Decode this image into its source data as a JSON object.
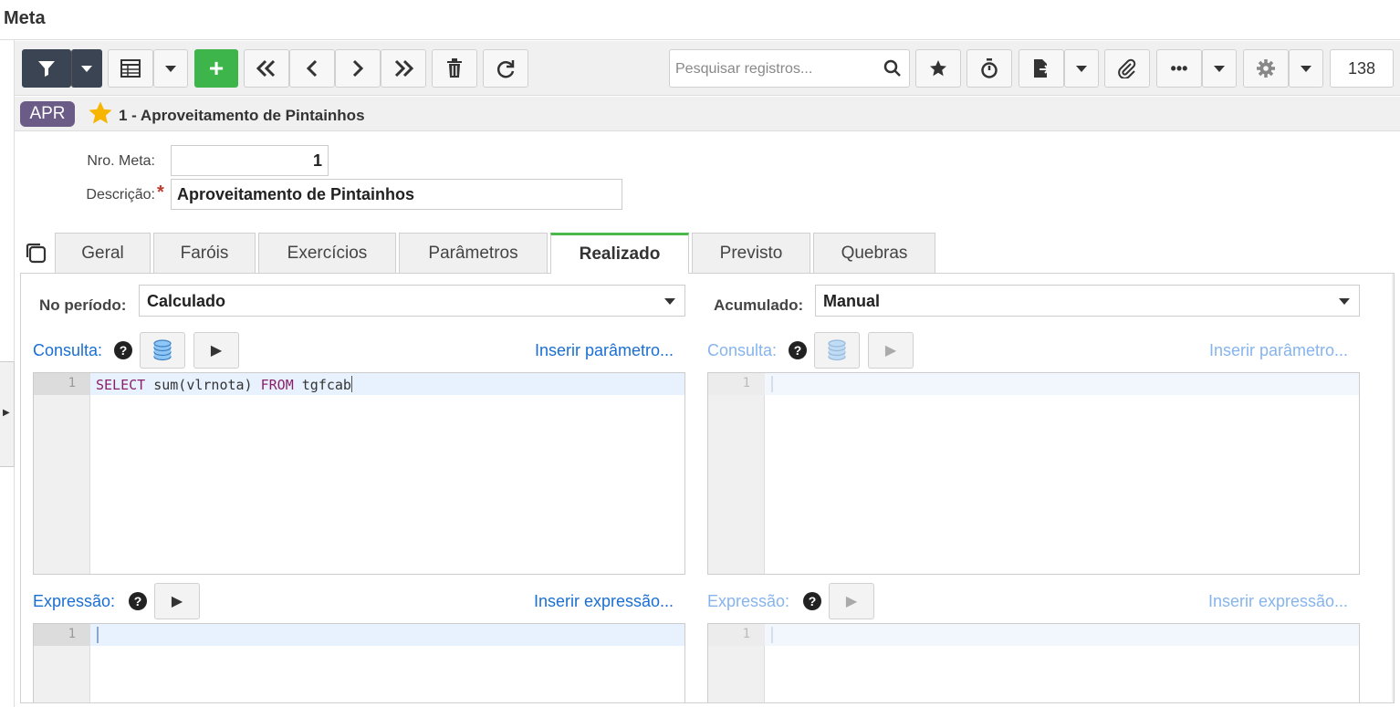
{
  "window": {
    "title": "Meta"
  },
  "toolbar": {
    "search_placeholder": "Pesquisar registros...",
    "record_count": "138",
    "icons": [
      "filter-icon",
      "grid-icon",
      "add-icon",
      "first-icon",
      "prev-icon",
      "next-icon",
      "last-icon",
      "trash-icon",
      "refresh-icon",
      "search-icon",
      "star-icon",
      "stopwatch-icon",
      "export-icon",
      "paperclip-icon",
      "more-icon",
      "gear-icon"
    ],
    "colors": {
      "add": "#3db54a",
      "filter": "#3a4452"
    }
  },
  "record": {
    "badge": "APR",
    "badge_color": "#6b5b87",
    "title": "1 - Aproveitamento de Pintainhos"
  },
  "form": {
    "nro_label": "Nro. Meta:",
    "nro_value": "1",
    "desc_label": "Descrição:",
    "desc_required": "*",
    "desc_value": "Aproveitamento de Pintainhos"
  },
  "tabs": [
    {
      "label": "Geral"
    },
    {
      "label": "Faróis"
    },
    {
      "label": "Exercícios"
    },
    {
      "label": "Parâmetros"
    },
    {
      "label": "Realizado",
      "active": true
    },
    {
      "label": "Previsto"
    },
    {
      "label": "Quebras"
    }
  ],
  "realizado": {
    "left": {
      "period_label": "No período:",
      "period_value": "Calculado",
      "consulta_label": "Consulta:",
      "insert_param": "Inserir parâmetro...",
      "consulta_line": "1",
      "consulta_code": {
        "kw1": "SELECT",
        "t1": " sum(vlrnota) ",
        "kw2": "FROM",
        "t2": " tgfcab"
      },
      "expressao_label": "Expressão:",
      "insert_expr": "Inserir expressão...",
      "expressao_line": "1"
    },
    "right": {
      "accum_label": "Acumulado:",
      "accum_value": "Manual",
      "consulta_label": "Consulta:",
      "insert_param": "Inserir parâmetro...",
      "consulta_line": "1",
      "expressao_label": "Expressão:",
      "insert_expr": "Inserir expressão...",
      "expressao_line": "1"
    }
  }
}
